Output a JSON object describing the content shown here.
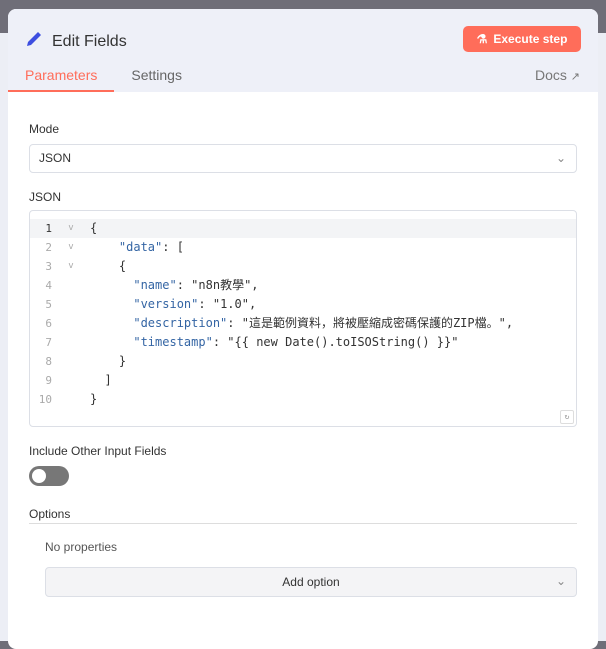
{
  "header": {
    "title": "Edit Fields",
    "execute_label": "Execute step"
  },
  "tabs": [
    {
      "label": "Parameters",
      "active": true
    },
    {
      "label": "Settings",
      "active": false
    }
  ],
  "docs_label": "Docs",
  "mode": {
    "label": "Mode",
    "value": "JSON"
  },
  "json": {
    "label": "JSON",
    "lines": [
      {
        "n": "1",
        "fold": "v",
        "indent": "",
        "parts": [
          [
            "v",
            "{"
          ]
        ]
      },
      {
        "n": "2",
        "fold": "v",
        "indent": "    ",
        "parts": [
          [
            "k",
            "\"data\""
          ],
          [
            "v",
            ": ["
          ]
        ]
      },
      {
        "n": "3",
        "fold": "v",
        "indent": "    ",
        "parts": [
          [
            "v",
            "{"
          ]
        ]
      },
      {
        "n": "4",
        "fold": "",
        "indent": "      ",
        "parts": [
          [
            "k",
            "\"name\""
          ],
          [
            "v",
            ": \"n8n教學\","
          ]
        ]
      },
      {
        "n": "5",
        "fold": "",
        "indent": "      ",
        "parts": [
          [
            "k",
            "\"version\""
          ],
          [
            "v",
            ": \"1.0\","
          ]
        ]
      },
      {
        "n": "6",
        "fold": "",
        "indent": "      ",
        "parts": [
          [
            "k",
            "\"description\""
          ],
          [
            "v",
            ": \"這是範例資料，將被壓縮成密碼保護的ZIP檔。\","
          ]
        ]
      },
      {
        "n": "7",
        "fold": "",
        "indent": "      ",
        "parts": [
          [
            "k",
            "\"timestamp\""
          ],
          [
            "v",
            ": \"{{ new Date().toISOString() }}\""
          ]
        ]
      },
      {
        "n": "8",
        "fold": "",
        "indent": "    ",
        "parts": [
          [
            "v",
            "}"
          ]
        ]
      },
      {
        "n": "9",
        "fold": "",
        "indent": "  ",
        "parts": [
          [
            "v",
            "]"
          ]
        ]
      },
      {
        "n": "10",
        "fold": "",
        "indent": "",
        "parts": [
          [
            "v",
            "}"
          ]
        ]
      }
    ]
  },
  "include_other": {
    "label": "Include Other Input Fields",
    "enabled": false
  },
  "options": {
    "label": "Options",
    "empty_text": "No properties",
    "add_label": "Add option"
  },
  "colors": {
    "accent": "#ff6d5a",
    "pencil": "#3d4ee0"
  }
}
